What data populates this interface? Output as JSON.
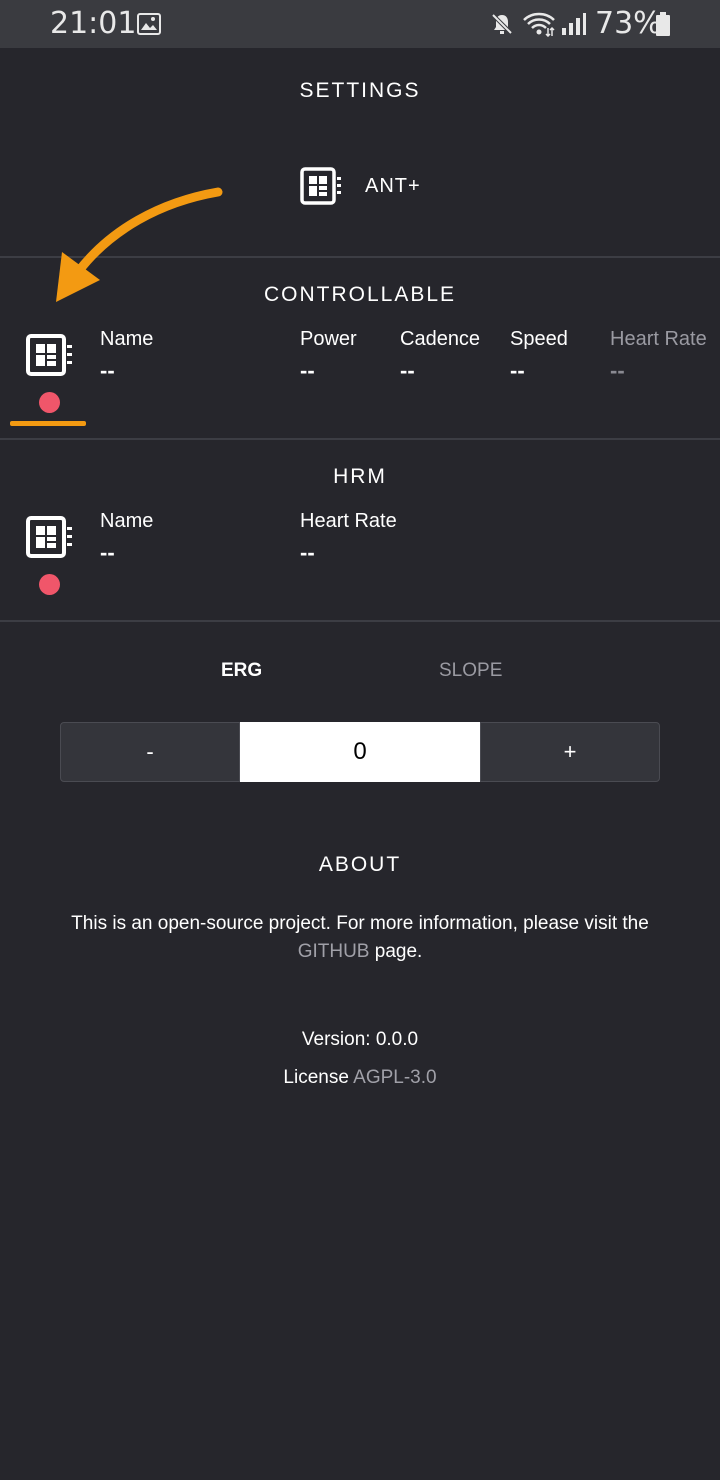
{
  "status_bar": {
    "time": "21:01",
    "battery": "73%",
    "icons": [
      "image-icon",
      "mute-icon",
      "wifi-icon",
      "signal-icon",
      "battery-icon"
    ]
  },
  "settings": {
    "title": "SETTINGS",
    "ant_label": "ANT+"
  },
  "controllable": {
    "title": "CONTROLLABLE",
    "columns": [
      {
        "label": "Name",
        "value": "--"
      },
      {
        "label": "Power",
        "value": "--"
      },
      {
        "label": "Cadence",
        "value": "--"
      },
      {
        "label": "Speed",
        "value": "--"
      },
      {
        "label": "Heart Rate",
        "value": "--"
      }
    ]
  },
  "hrm": {
    "title": "HRM",
    "columns": [
      {
        "label": "Name",
        "value": "--"
      },
      {
        "label": "Heart Rate",
        "value": "--"
      }
    ]
  },
  "mode": {
    "tabs": [
      "ERG",
      "SLOPE"
    ],
    "active": "ERG"
  },
  "stepper": {
    "minus_label": "-",
    "value": "0",
    "plus_label": "+"
  },
  "about": {
    "title": "ABOUT",
    "text_part1": "This is an open-source project. For more information, please visit the",
    "link_text": "GITHUB",
    "text_part2": " page.",
    "version": "Version: 0.0.0",
    "license_label": "License ",
    "license_link": "AGPL-3.0"
  },
  "colors": {
    "background": "#26262c",
    "status_dot": "#f0566a",
    "annotation": "#f39a12"
  }
}
